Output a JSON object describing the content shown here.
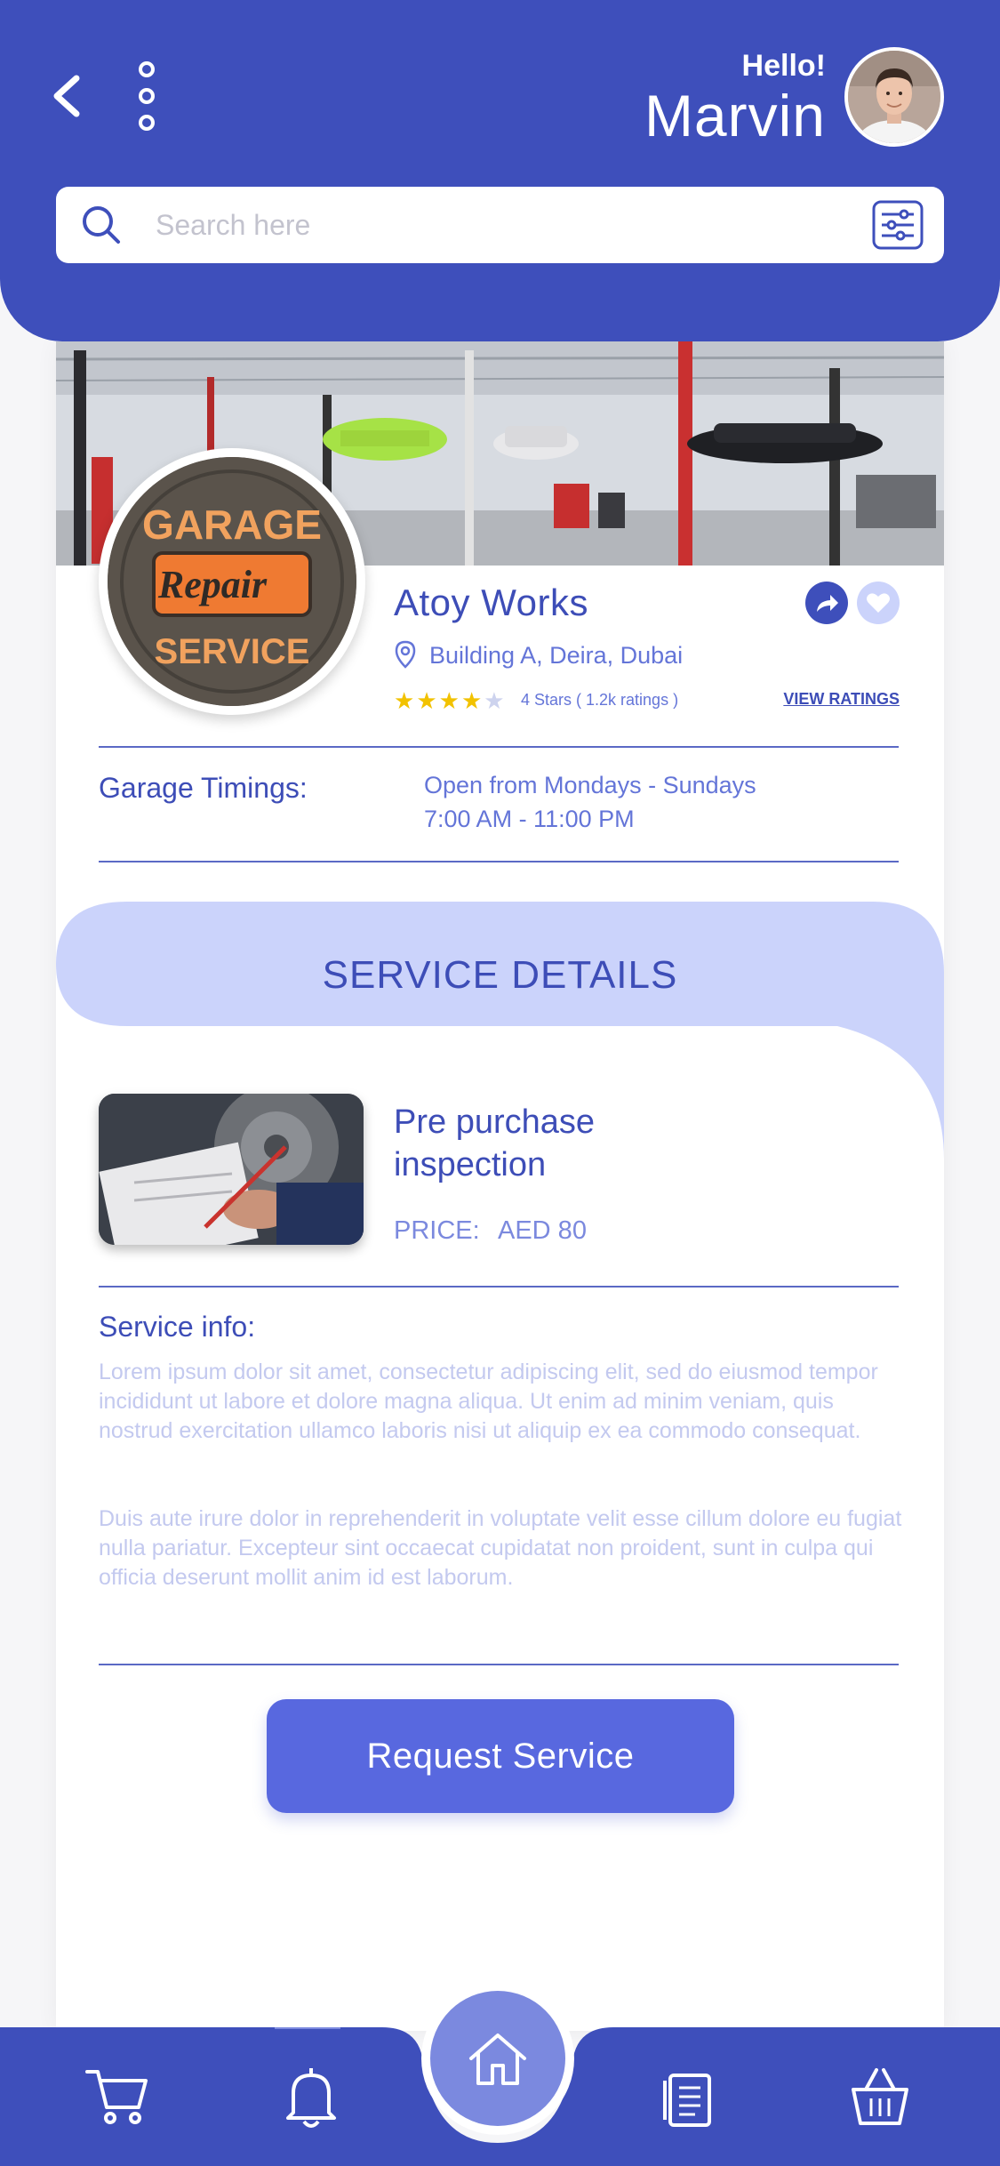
{
  "header": {
    "greeting": "Hello!",
    "user_name": "Marvin",
    "search_placeholder": "Search here"
  },
  "garage": {
    "name": "Atoy Works",
    "address": "Building A, Deira, Dubai",
    "rating_stars": 4,
    "rating_max": 5,
    "rating_text": "4 Stars ( 1.2k ratings )",
    "view_ratings_label": "VIEW RATINGS",
    "logo_text": {
      "top": "GARAGE",
      "middle": "Repair",
      "bottom": "SERVICE"
    }
  },
  "timings": {
    "label": "Garage Timings:",
    "days": "Open from Mondays - Sundays",
    "hours": "7:00 AM - 11:00 PM"
  },
  "service": {
    "section_title": "SERVICE DETAILS",
    "name": "Pre purchase inspection",
    "price_label": "PRICE:",
    "price_value": "AED 80",
    "info_label": "Service info:",
    "info_paragraph_1": "Lorem ipsum dolor sit amet, consectetur adipiscing elit, sed do eiusmod tempor incididunt ut labore et dolore magna aliqua. Ut enim ad minim veniam, quis nostrud exercitation ullamco laboris nisi ut aliquip ex ea commodo consequat.",
    "info_paragraph_2": "Duis aute irure dolor in reprehenderit in voluptate velit esse cillum dolore eu fugiat nulla pariatur. Excepteur sint occaecat cupidatat non proident, sunt in culpa qui officia deserunt mollit anim id est laborum."
  },
  "actions": {
    "request_label": "Request Service"
  },
  "bottom_nav": {
    "items": [
      "cart-icon",
      "bell-icon",
      "home-icon",
      "document-icon",
      "basket-icon"
    ],
    "active": "home-icon"
  },
  "colors": {
    "primary": "#3e4fbb",
    "accent": "#5868df",
    "light": "#cbd3fb",
    "star": "#f2c200"
  }
}
